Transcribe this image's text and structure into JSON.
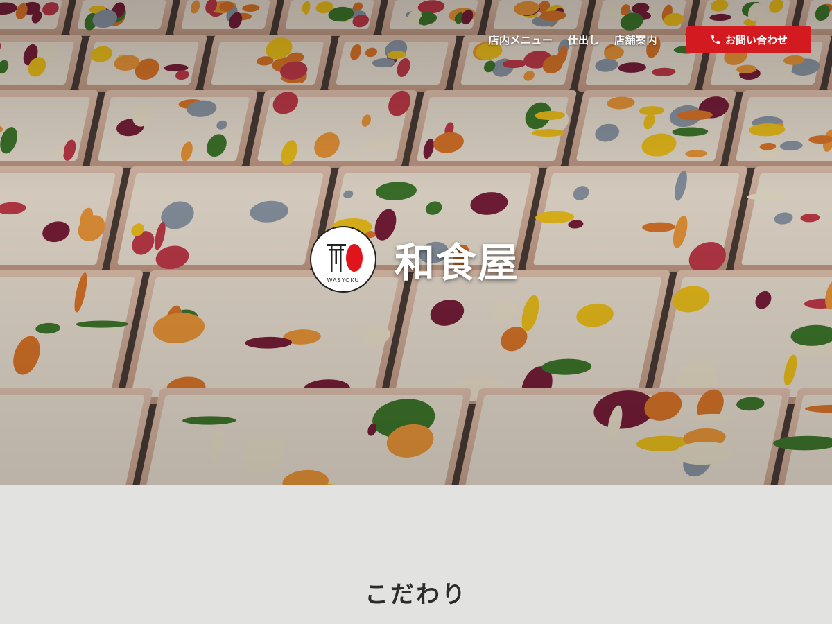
{
  "nav": {
    "items": [
      {
        "label": "店内メニュー"
      },
      {
        "label": "仕出し"
      },
      {
        "label": "店舗案内"
      }
    ],
    "contact_label": "お問い合わせ",
    "contact_icon": "phone-icon"
  },
  "logo": {
    "name": "和食屋",
    "sub": "WASYOKU"
  },
  "hero": {
    "image_description": "bento-boxes-photo"
  },
  "section": {
    "title": "こだわり"
  },
  "colors": {
    "accent": "#d21a20",
    "background": "#e2e2e1",
    "heading": "#2c2c2c"
  }
}
